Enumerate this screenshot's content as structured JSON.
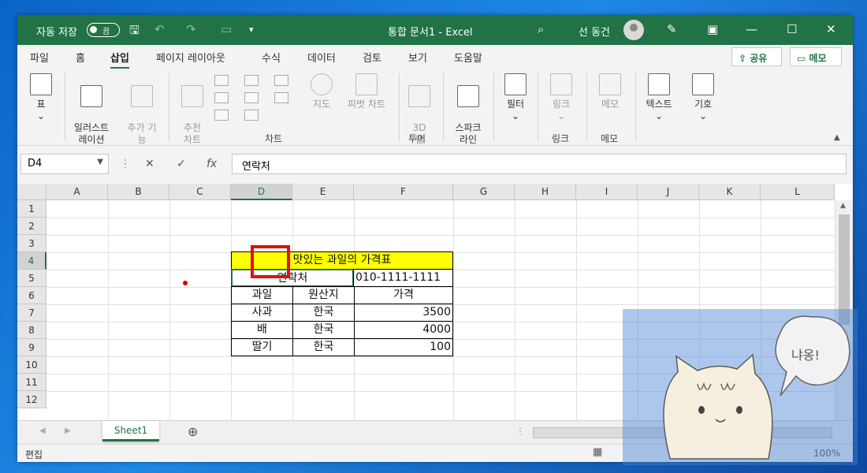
{
  "titlebar": {
    "autosave_label": "자동 저장",
    "autosave_state": "끔",
    "doc_title": "통합 문서1  -  Excel",
    "user_name": "선 동건"
  },
  "tabs": [
    "파일",
    "홈",
    "삽입",
    "페이지 레이아웃",
    "수식",
    "데이터",
    "검토",
    "보기",
    "도움말"
  ],
  "active_tab": "삽입",
  "share_label": "공유",
  "memo_label": "메모",
  "ribbon": {
    "table": "표",
    "illustration": "일러스트\n레이션",
    "addins": "추가 기\n능",
    "rec_charts": "추천\n차트",
    "map": "지도",
    "pivot_chart": "피벗 차트",
    "map3d": "3D\n맵",
    "sparkline": "스파크\n라인",
    "filter": "필터",
    "link": "링크",
    "memo": "메모",
    "text": "텍스트",
    "symbol": "기호",
    "groups": {
      "chart": "차트",
      "tour": "투어",
      "link": "링크",
      "memo": "메모"
    }
  },
  "formula_bar": {
    "name_box": "D4",
    "cancel": "✕",
    "confirm": "✓",
    "fx": "fx",
    "formula": "연락처"
  },
  "columns": [
    "A",
    "B",
    "C",
    "D",
    "E",
    "F",
    "G",
    "H",
    "I",
    "J",
    "K",
    "L"
  ],
  "rows": [
    "1",
    "2",
    "3",
    "4",
    "5",
    "6",
    "7",
    "8",
    "9",
    "10",
    "11",
    "12"
  ],
  "selected_column": "D",
  "selected_row": "4",
  "sheet": {
    "title": "맛있는 과일의 가격표",
    "contact_label": "연락처",
    "contact_value": "010-1111-1111",
    "headers": [
      "과일",
      "원산지",
      "가격"
    ],
    "data": [
      [
        "사과",
        "한국",
        "3500"
      ],
      [
        "배",
        "한국",
        "4000"
      ],
      [
        "딸기",
        "한국",
        "100"
      ]
    ],
    "highlight_color": "#ffff00"
  },
  "sheet_tabs": [
    "Sheet1"
  ],
  "status": {
    "mode": "편집",
    "zoom": "100%"
  },
  "watermark_text": "냐옹!",
  "accent": "#217346"
}
